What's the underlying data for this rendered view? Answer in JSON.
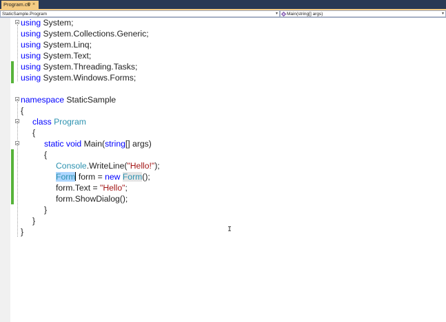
{
  "tab": {
    "title": "Program.cs",
    "pin": "⊕",
    "close": "×"
  },
  "nav": {
    "left": "StaticSample.Program",
    "right": "Main(string[] args)",
    "arrow": "▾"
  },
  "code": {
    "l1": [
      "using",
      " System;"
    ],
    "l2": [
      "using",
      " System.Collections.Generic;"
    ],
    "l3": [
      "using",
      " System.Linq;"
    ],
    "l4": [
      "using",
      " System.Text;"
    ],
    "l5": [
      "using",
      " System.Threading.Tasks;"
    ],
    "l6": [
      "using",
      " System.Windows.Forms;"
    ],
    "l8": [
      "namespace",
      " StaticSample"
    ],
    "l9": "{",
    "l10": [
      "class",
      "Program"
    ],
    "l11": "{",
    "l12": [
      "static",
      "void",
      " Main(",
      "string",
      "[] args)"
    ],
    "l13": "{",
    "l14": [
      "Console",
      ".WriteLine(",
      "\"Hello!\"",
      ");"
    ],
    "l15": [
      "Form",
      " form = ",
      "new",
      "Form",
      "();"
    ],
    "l16": [
      "form.Text = ",
      "\"Hello\"",
      ";"
    ],
    "l17": "form.ShowDialog();",
    "l18": "}",
    "l19": "}",
    "l20": "}"
  },
  "cursor_glyph": "I"
}
